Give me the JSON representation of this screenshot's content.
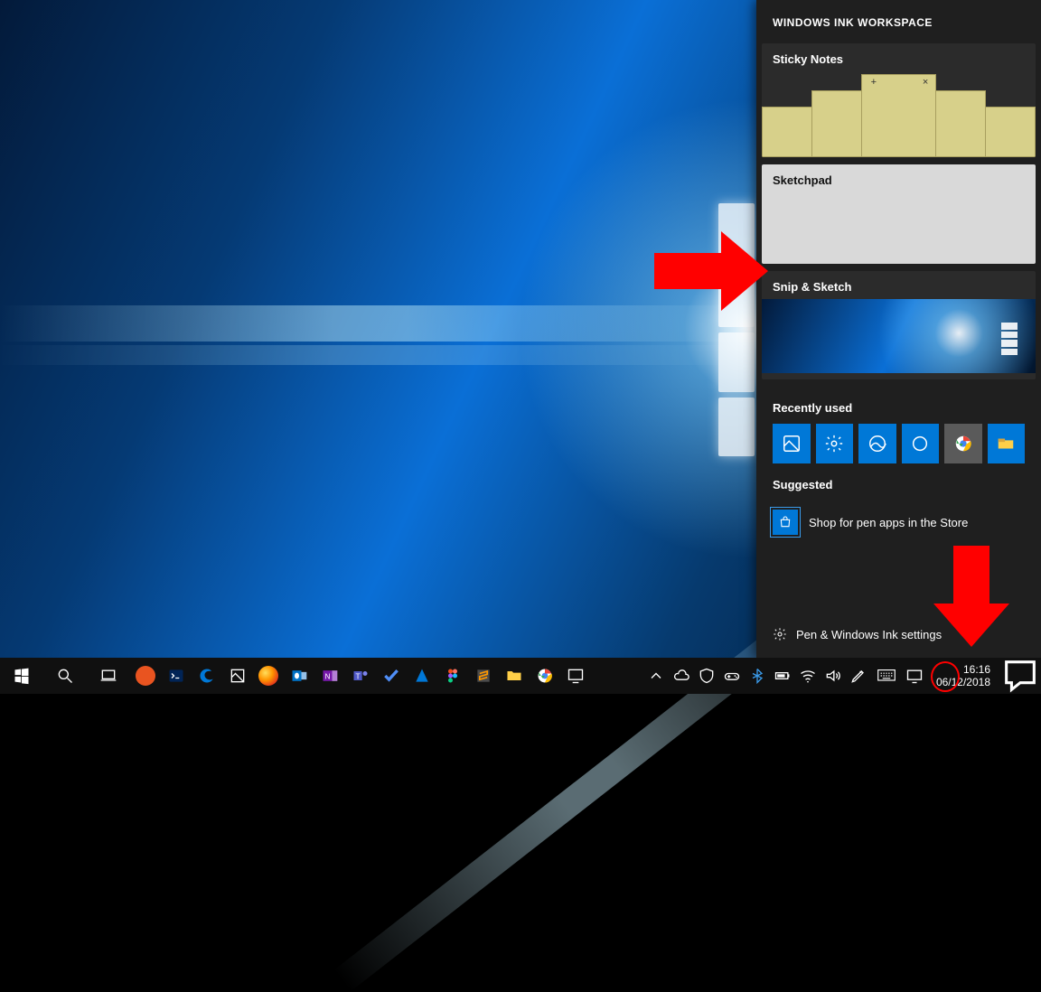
{
  "ink": {
    "title": "WINDOWS INK WORKSPACE",
    "sticky_label": "Sticky Notes",
    "sketch_label": "Sketchpad",
    "snip_label": "Snip & Sketch",
    "recent_label": "Recently used",
    "suggested_label": "Suggested",
    "suggested_link": "Shop for pen apps in the Store",
    "settings_label": "Pen & Windows Ink settings",
    "recent_apps": [
      {
        "name": "snip-sketch",
        "color": "#0078d7"
      },
      {
        "name": "settings",
        "color": "#0078d7"
      },
      {
        "name": "photos",
        "color": "#0078d7"
      },
      {
        "name": "cortana",
        "color": "#0078d7"
      },
      {
        "name": "chrome",
        "color": "#5a5a5a"
      },
      {
        "name": "file-explorer",
        "color": "#0078d7"
      }
    ]
  },
  "taskbar": {
    "clock_time": "16:16",
    "clock_date": "06/12/2018",
    "pinned": [
      "start",
      "search",
      "task-view",
      "ubuntu",
      "powershell",
      "edge",
      "snip",
      "firefox",
      "outlook",
      "onenote",
      "teams",
      "todo",
      "azure",
      "figma",
      "sublime",
      "files",
      "chrome",
      "snip2"
    ],
    "tray": [
      "overflow",
      "onedrive",
      "defender",
      "controller",
      "bluetooth",
      "battery",
      "wifi",
      "volume",
      "ink",
      "keyboard",
      "display"
    ]
  },
  "annotations": {
    "arrow_to_sketchpad": true,
    "arrow_to_tray_ink": true,
    "circle_tray_ink": true
  }
}
